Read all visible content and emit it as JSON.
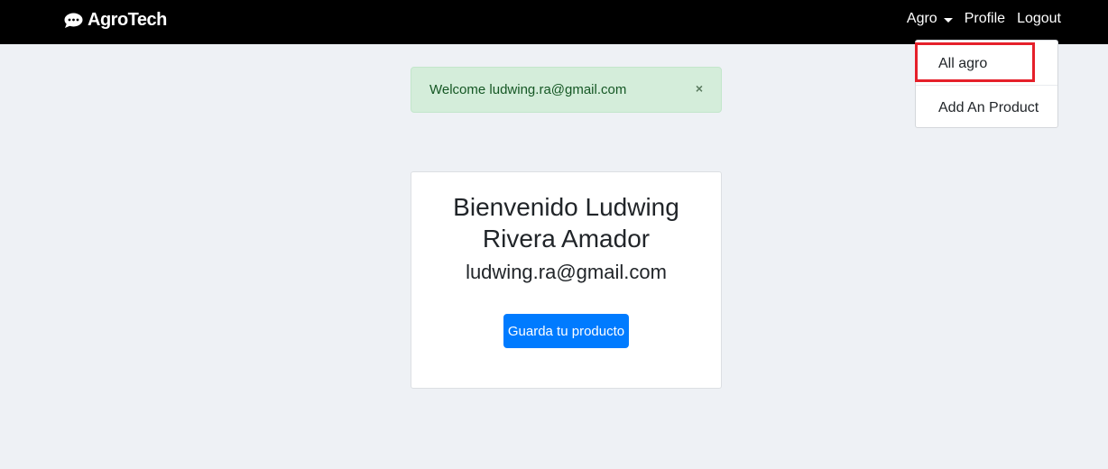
{
  "navbar": {
    "brand": "AgroTech",
    "brand_icon": "comment-dots-icon",
    "dropdown_label": "Agro",
    "profile_label": "Profile",
    "logout_label": "Logout"
  },
  "dropdown": {
    "items": [
      {
        "label": "All agro"
      },
      {
        "label": "Add An Product"
      }
    ],
    "highlight_color": "#e5202a"
  },
  "alert": {
    "message": "Welcome ludwing.ra@gmail.com",
    "close_symbol": "×"
  },
  "card": {
    "title": "Bienvenido Ludwing Rivera Amador",
    "email": "ludwing.ra@gmail.com",
    "button_label": "Guarda tu producto"
  },
  "colors": {
    "navbar_bg": "#000000",
    "page_bg": "#eef1f5",
    "alert_bg": "#d4edda",
    "alert_text": "#155724",
    "primary_button": "#007bff"
  }
}
